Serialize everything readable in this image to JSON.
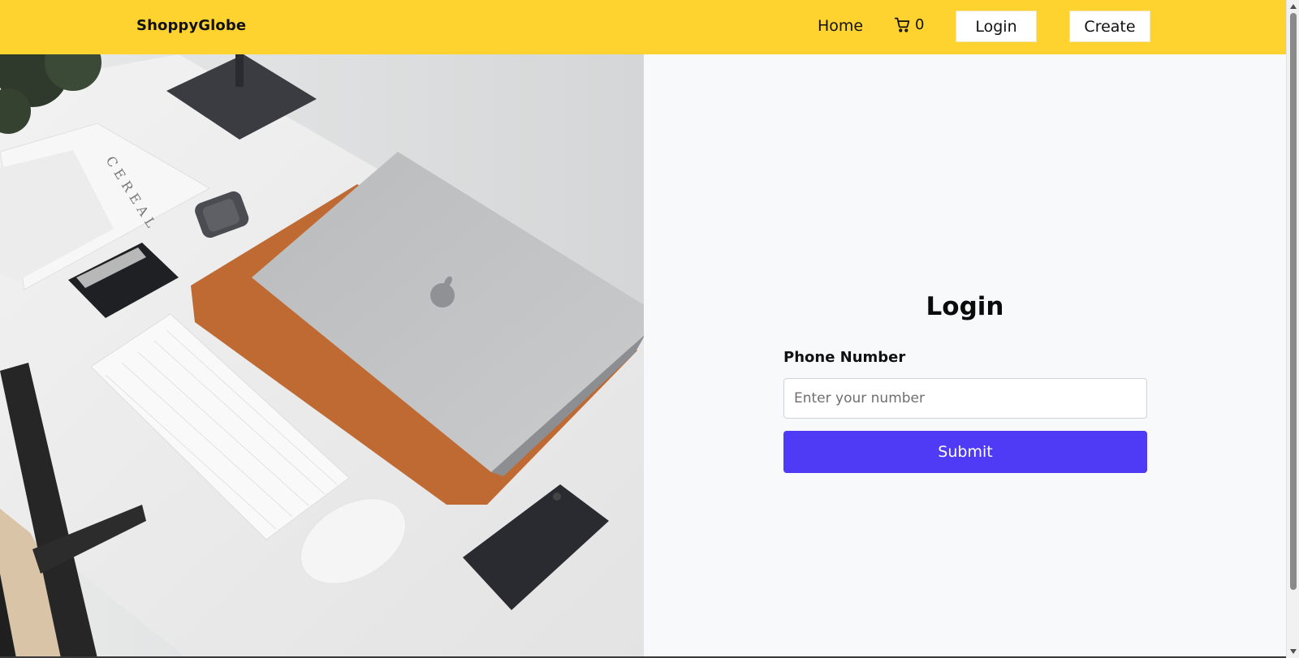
{
  "navbar": {
    "brand": "ShoppyGlobe",
    "home_label": "Home",
    "cart_count": "0",
    "login_label": "Login",
    "create_label": "Create",
    "cart_icon": "cart-icon"
  },
  "hero": {
    "image_desc": "desk-flatlay-photo",
    "book_title": "CEREAL"
  },
  "login_form": {
    "title": "Login",
    "phone_label": "Phone Number",
    "phone_placeholder": "Enter your number",
    "phone_value": "",
    "submit_label": "Submit"
  },
  "colors": {
    "navbar_bg": "#fed330",
    "submit_bg": "#4f3af6",
    "panel_bg": "#f8f9fa"
  }
}
